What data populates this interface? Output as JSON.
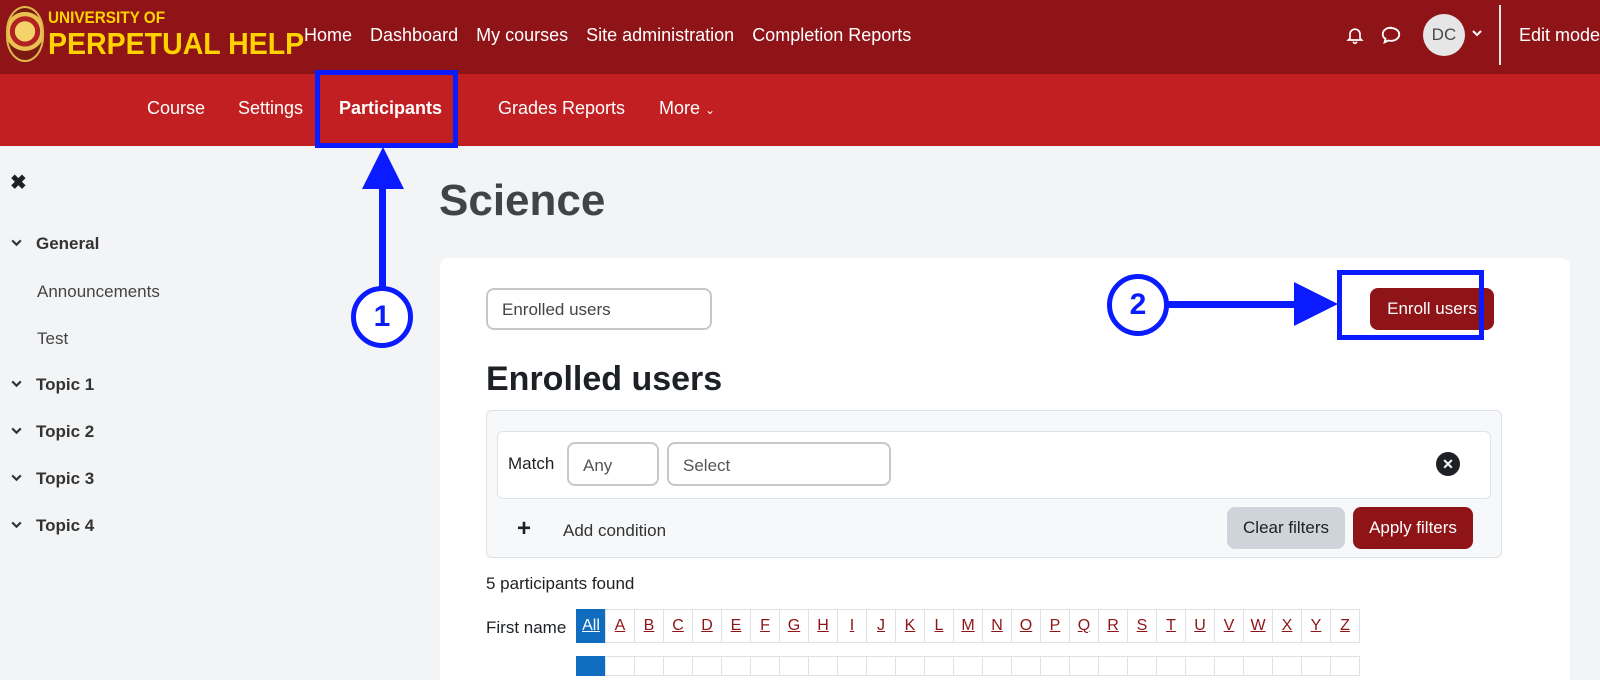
{
  "logo": {
    "line1": "UNIVERSITY OF",
    "line2": "PERPETUAL HELP"
  },
  "primary_nav": [
    "Home",
    "Dashboard",
    "My courses",
    "Site administration",
    "Completion Reports"
  ],
  "user": {
    "initials": "DC",
    "edit_mode": "Edit mode"
  },
  "secondary_nav": {
    "course": "Course",
    "settings": "Settings",
    "participants": "Participants",
    "grades": "Grades",
    "reports": "Reports",
    "more": "More"
  },
  "sidebar": {
    "sections": [
      {
        "label": "General",
        "items": [
          "Announcements",
          "Test"
        ]
      },
      {
        "label": "Topic 1"
      },
      {
        "label": "Topic 2"
      },
      {
        "label": "Topic 3"
      },
      {
        "label": "Topic 4"
      }
    ]
  },
  "page": {
    "title": "Science"
  },
  "participants": {
    "view_select": "Enrolled users",
    "enroll_button": "Enroll users",
    "heading": "Enrolled users",
    "filter": {
      "match_label": "Match",
      "match_value": "Any",
      "type_placeholder": "Select",
      "add_condition": "Add condition",
      "clear_filters": "Clear filters",
      "apply_filters": "Apply filters"
    },
    "found": "5 participants found",
    "first_name_label": "First name",
    "initials": [
      "All",
      "A",
      "B",
      "C",
      "D",
      "E",
      "F",
      "G",
      "H",
      "I",
      "J",
      "K",
      "L",
      "M",
      "N",
      "O",
      "P",
      "Q",
      "R",
      "S",
      "T",
      "U",
      "V",
      "W",
      "X",
      "Y",
      "Z"
    ]
  },
  "annotations": {
    "step1": "1",
    "step2": "2"
  },
  "colors": {
    "brand_dark": "#8e1417",
    "brand": "#c21f22",
    "annotation": "#0a1bff",
    "link_active": "#0f6cbf"
  }
}
